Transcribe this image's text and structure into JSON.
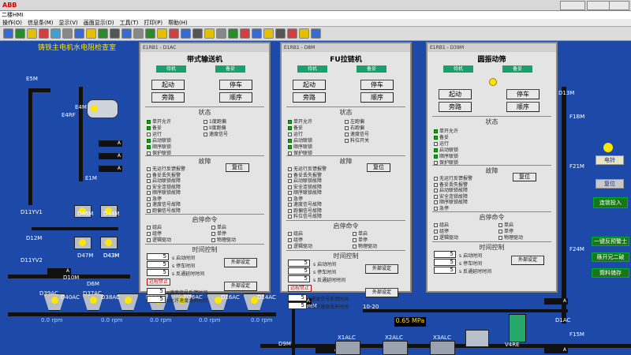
{
  "window": {
    "titlebar": "二楼HMI",
    "winbtns": [
      "",
      "",
      ""
    ]
  },
  "menu": [
    "操作(O)",
    "信息条(M)",
    "显示(V)",
    "画面显示(D)",
    "工具(T)",
    "打印(P)",
    "帮助(H)"
  ],
  "screen_title": "铸铁主电机水电阻检查室",
  "panels": [
    {
      "wintitle": "E1RB1 - D1AC",
      "name": "带式输送机",
      "stat1": "待机",
      "stat2": "备妥",
      "btn_start": "起动",
      "btn_stop": "停车",
      "btn_bypass": "旁路",
      "btn_seq": "顺序",
      "section_status": "状态",
      "status_left": [
        "单开允许",
        "备妥",
        "运行",
        "启动联锁",
        "顺序联锁",
        "保护联锁"
      ],
      "status_left_on": [
        true,
        true,
        false,
        true,
        true,
        false
      ],
      "status_right": [
        "1度跑偏",
        "II度跑偏",
        "速度信号"
      ],
      "section_fault": "故障",
      "reset": "复位",
      "faults": [
        "无运行反馈报警",
        "备妥丢失报警",
        "启动联锁故障",
        "安全连锁故障",
        "顺序联锁故障",
        "急停",
        "速度信号故障",
        "跑偏信号故障"
      ],
      "section_cmd": "启停命令",
      "cmd_left": [
        "组启",
        "组停",
        "逻辑驱动"
      ],
      "cmd_right": [
        "单启",
        "单停",
        "物理驱动"
      ],
      "section_time": "时间控制",
      "times": [
        {
          "v": "5",
          "u": "s",
          "t": "启动时间"
        },
        {
          "v": "5",
          "u": "s",
          "t": "停车时间"
        },
        {
          "v": "5",
          "u": "s",
          "t": "反通延时时间"
        }
      ],
      "ext": "外部设定",
      "ext2": "外部设定",
      "remote": "远程禁止",
      "bottom": [
        {
          "v": "5",
          "u": "s",
          "t": "速度信号反馈时间"
        },
        {
          "v": "5",
          "u": "s",
          "t": "允许速度丢失时间"
        }
      ]
    },
    {
      "wintitle": "E1RB1 - D8M",
      "name": "FU拉链机",
      "stat1": "待机",
      "stat2": "备妥",
      "btn_start": "起动",
      "btn_stop": "停车",
      "btn_bypass": "旁路",
      "btn_seq": "顺序",
      "section_status": "状态",
      "status_left": [
        "单开允许",
        "备妥",
        "运行",
        "启动联锁",
        "顺序联锁",
        "保护联锁"
      ],
      "status_left_on": [
        true,
        true,
        false,
        true,
        true,
        false
      ],
      "status_right": [
        "左跑偏",
        "右跑偏",
        "速度信号",
        "料位开关"
      ],
      "section_fault": "故障",
      "reset": "复位",
      "faults": [
        "无运行反馈报警",
        "备妥丢失报警",
        "启动联锁故障",
        "安全连锁故障",
        "顺序联锁故障",
        "急停",
        "速度信号故障",
        "跑偏信号故障",
        "料位信号故障"
      ],
      "section_cmd": "启停命令",
      "cmd_left": [
        "组启",
        "组停",
        "逻辑驱动"
      ],
      "cmd_right": [
        "单启",
        "单停",
        "物理驱动"
      ],
      "section_time": "时间控制",
      "times": [
        {
          "v": "5",
          "u": "s",
          "t": "启动时间"
        },
        {
          "v": "5",
          "u": "s",
          "t": "停车时间"
        },
        {
          "v": "5",
          "u": "s",
          "t": "反通延时时间"
        }
      ],
      "ext": "外部设定",
      "ext2": "外部设定",
      "remote": "远程禁止",
      "bottom": [
        {
          "v": "5",
          "u": "s",
          "t": "速度信号反馈时间"
        },
        {
          "v": "5",
          "u": "s",
          "t": "允许速度丢失时间"
        }
      ]
    },
    {
      "wintitle": "E1RB1 - D39M",
      "name": "圆振动筛",
      "stat1": "待机",
      "stat2": "备妥",
      "btn_start": "起动",
      "btn_stop": "停车",
      "btn_bypass": "旁路",
      "btn_seq": "顺序",
      "section_status": "状态",
      "status_left": [
        "单开允许",
        "备妥",
        "运行",
        "启动联锁",
        "顺序联锁",
        "保护联锁"
      ],
      "status_left_on": [
        true,
        true,
        false,
        true,
        true,
        false
      ],
      "status_right": [],
      "section_fault": "故障",
      "reset": "复位",
      "faults": [
        "无运行反馈报警",
        "备妥丢失报警",
        "启动联锁故障",
        "安全连锁故障",
        "顺序联锁故障",
        "急停"
      ],
      "section_cmd": "启停命令",
      "cmd_left": [
        "组启",
        "组停",
        "逻辑驱动"
      ],
      "cmd_right": [
        "单启",
        "单停",
        "物理驱动"
      ],
      "section_time": "时间控制",
      "times": [
        {
          "v": "5",
          "u": "s",
          "t": "启动时间"
        },
        {
          "v": "5",
          "u": "s",
          "t": "停车时间"
        },
        {
          "v": "5",
          "u": "s",
          "t": "反通延时时间"
        }
      ],
      "ext": "外部设定",
      "ext2": "",
      "remote": "",
      "bottom": []
    }
  ],
  "right_buttons": {
    "bell": "电铃",
    "reset": "复位",
    "link": "连锁投入",
    "y1": "一键反预警士",
    "y2": "篠开兄二破",
    "y3": "筒料储存"
  },
  "labels": [
    "E5M",
    "E4M",
    "E4RF",
    "E1M",
    "D11YV1",
    "D12M",
    "D11YV2",
    "D10M",
    "D46M",
    "D44M",
    "D47M",
    "D43M",
    "D39AC",
    "D40AC",
    "D37AC",
    "D38AC",
    "D28AC",
    "D26AC",
    "D16AC",
    "D14AC",
    "D6M",
    "D8M",
    "D9M",
    "D43M",
    "D42M",
    "D33Y",
    "D34Y",
    "D35M",
    "D36M",
    "D2M",
    "F1BM",
    "F21M",
    "F24M",
    "F15M",
    "V4RE",
    "X1ALC",
    "X2ALC",
    "X3ALC",
    "10-20",
    "D1AC",
    "D13M"
  ],
  "readouts": {
    "rpm1": "0.0",
    "rpm2": "0.0",
    "rpm3": "0.0",
    "rpm4": "0.0",
    "rpm5": "0.0",
    "mpa": "0.65",
    "mpa_unit": "MPa",
    "rpm_unit": "rpm",
    "amp": "A"
  }
}
